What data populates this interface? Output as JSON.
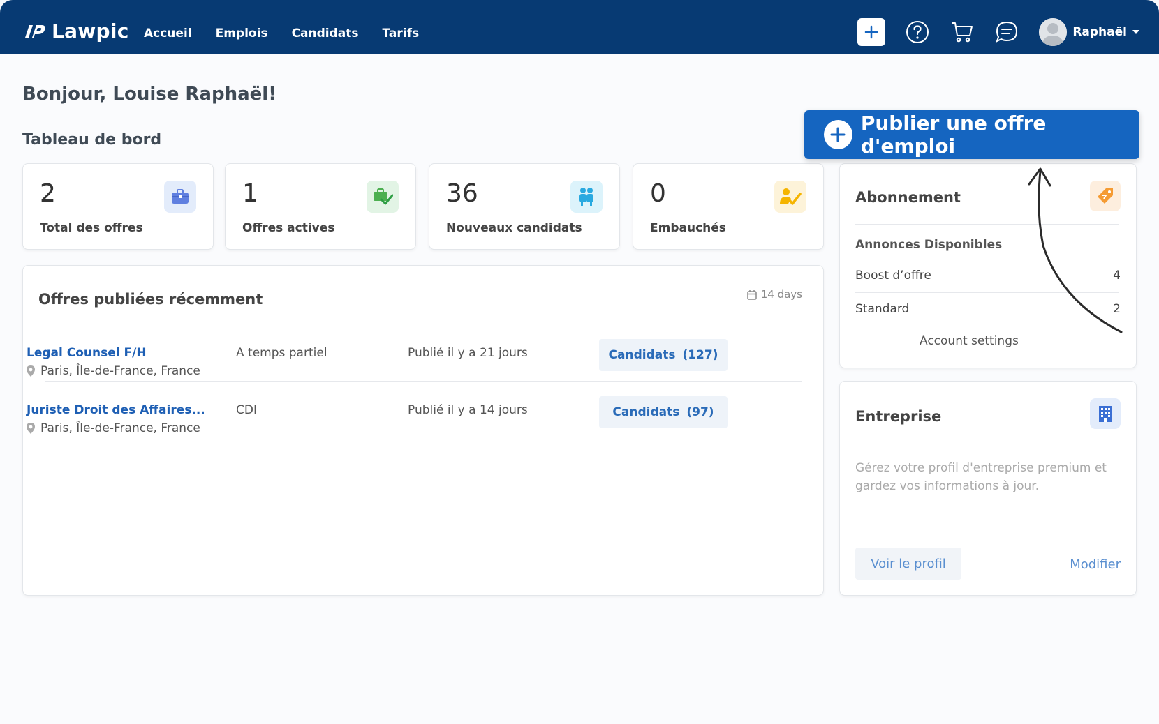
{
  "header": {
    "logo_text": "Lawpic",
    "nav": [
      "Accueil",
      "Emplois",
      "Candidats",
      "Tarifs"
    ],
    "user_name": "Raphaël"
  },
  "greeting": "Bonjour, Louise Raphaël!",
  "dashboard_title": "Tableau de bord",
  "publish_button_label": "Publier une offre d'emploi",
  "stats": [
    {
      "value": "2",
      "label": "Total des offres",
      "icon": "briefcase-icon"
    },
    {
      "value": "1",
      "label": "Offres actives",
      "icon": "briefcase-check-icon"
    },
    {
      "value": "36",
      "label": "Nouveaux candidats",
      "icon": "people-icon"
    },
    {
      "value": "0",
      "label": "Embauchés",
      "icon": "person-check-icon"
    }
  ],
  "recent": {
    "title": "Offres publiées récemment",
    "period": "14 days",
    "jobs": [
      {
        "title": "Legal Counsel F/H",
        "location": "Paris, Île-de-France, France",
        "type": "A temps partiel",
        "published": "Publié il y a 21 jours",
        "candidates_label": "Candidats",
        "candidates_count": "(127)"
      },
      {
        "title": "Juriste Droit des Affaires...",
        "location": "Paris, Île-de-France, France",
        "type": "CDI",
        "published": "Publié il y a 14 jours",
        "candidates_label": "Candidats",
        "candidates_count": "(97)"
      }
    ]
  },
  "subscription": {
    "title": "Abonnement",
    "available_label": "Annonces Disponibles",
    "rows": [
      {
        "label": "Boost d’offre",
        "value": "4"
      },
      {
        "label": "Standard",
        "value": "2"
      }
    ],
    "account_settings": "Account settings"
  },
  "company": {
    "title": "Entreprise",
    "description": "Gérez votre profil d'entreprise premium et gardez vos informations à jour.",
    "view_profile": "Voir le profil",
    "edit": "Modifier"
  },
  "colors": {
    "navbar": "#073a73",
    "primary": "#1565c0",
    "link": "#1e5fb4"
  }
}
